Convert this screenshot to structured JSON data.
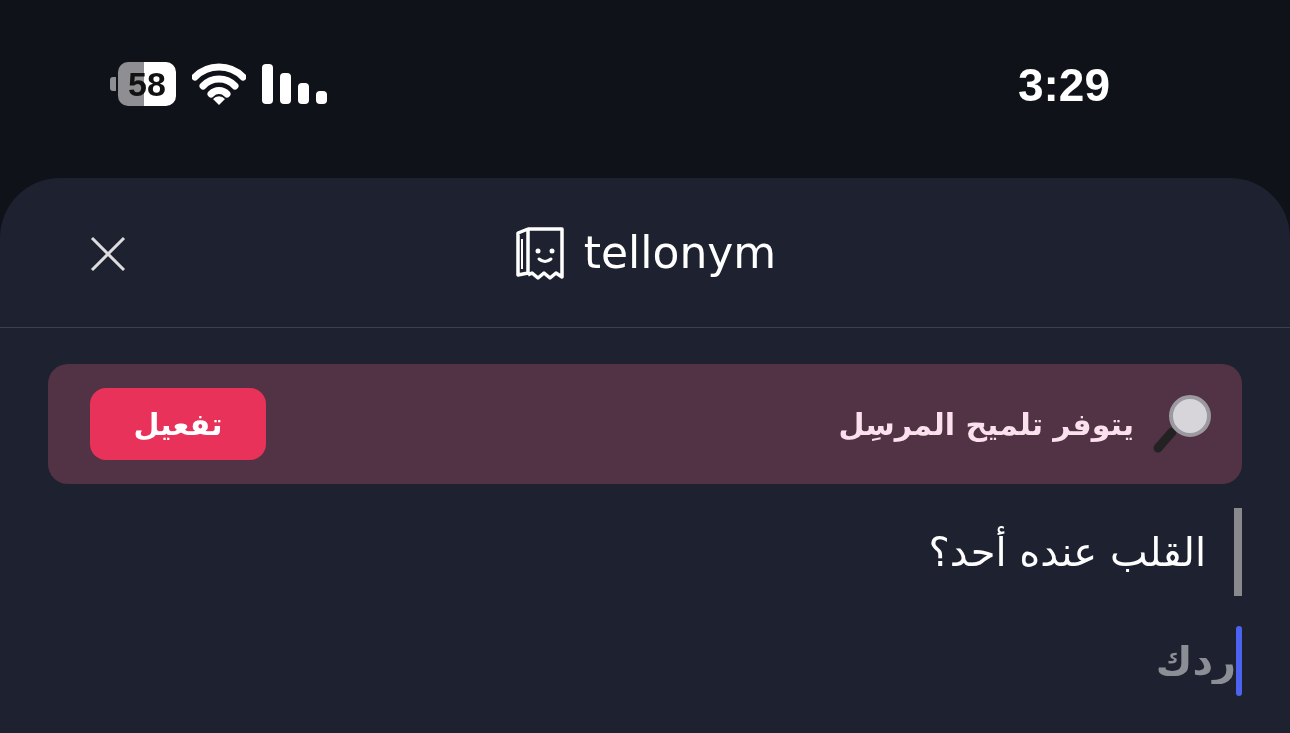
{
  "status_bar": {
    "battery": "58",
    "time": "3:29"
  },
  "header": {
    "logo_text": "tellonym"
  },
  "hint_banner": {
    "text": "يتوفر تلميح المرسِل",
    "button": "تفعيل"
  },
  "question": {
    "text": "القلب عنده أحد؟"
  },
  "answer": {
    "placeholder": "ردك"
  }
}
